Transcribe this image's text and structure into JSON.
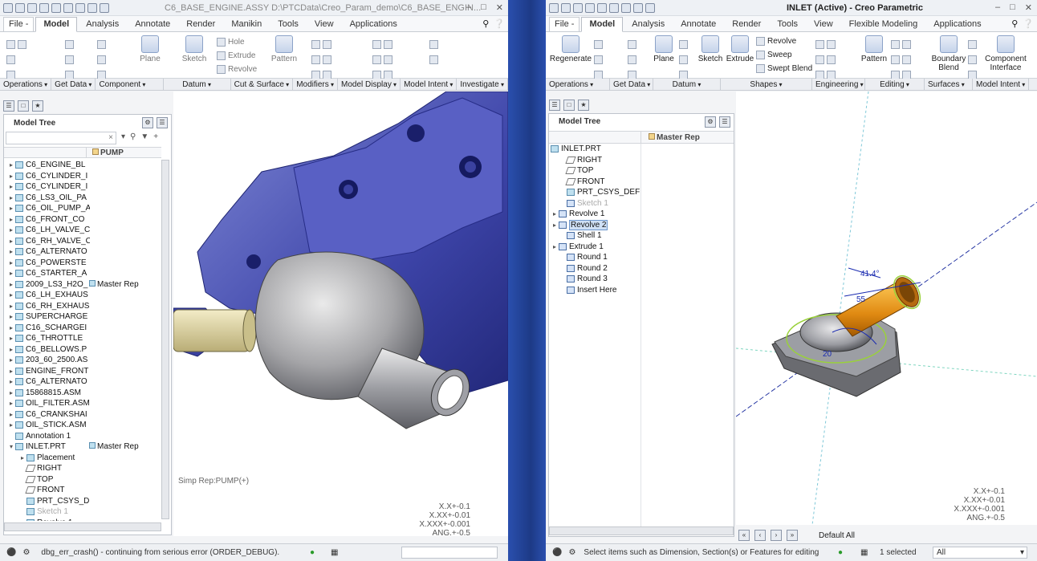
{
  "left": {
    "title": "C6_BASE_ENGINE.ASSY D:\\PTCData\\Creo_Param_demo\\C6_BASE_ENGIN...",
    "menu": [
      "File -",
      "Model",
      "Analysis",
      "Annotate",
      "Render",
      "Manikin",
      "Tools",
      "View",
      "Applications"
    ],
    "ribbon": {
      "plane": "Plane",
      "sketch": "Sketch",
      "hole": "Hole",
      "extrude": "Extrude",
      "revolve": "Revolve",
      "pattern": "Pattern"
    },
    "groups": [
      "Operations",
      "Get Data",
      "Component",
      "Datum",
      "Cut & Surface",
      "Modifiers",
      "Model Display",
      "Model Intent",
      "Investigate"
    ],
    "tree_title": "Model Tree",
    "col_header": "PUMP",
    "tree_rows": [
      {
        "label": "C6_ENGINE_BL",
        "rep": ""
      },
      {
        "label": "C6_CYLINDER_I",
        "rep": ""
      },
      {
        "label": "C6_CYLINDER_I",
        "rep": ""
      },
      {
        "label": "C6_LS3_OIL_PA",
        "rep": ""
      },
      {
        "label": "C6_OIL_PUMP_A",
        "rep": ""
      },
      {
        "label": "C6_FRONT_CO",
        "rep": ""
      },
      {
        "label": "C6_LH_VALVE_C",
        "rep": ""
      },
      {
        "label": "C6_RH_VALVE_C",
        "rep": ""
      },
      {
        "label": "C6_ALTERNATO",
        "rep": ""
      },
      {
        "label": "C6_POWERSTE",
        "rep": ""
      },
      {
        "label": "C6_STARTER_A",
        "rep": ""
      },
      {
        "label": "2009_LS3_H2O_",
        "rep": "Master Rep"
      },
      {
        "label": "C6_LH_EXHAUS",
        "rep": ""
      },
      {
        "label": "C6_RH_EXHAUS",
        "rep": ""
      },
      {
        "label": "SUPERCHARGE",
        "rep": ""
      },
      {
        "label": "C16_SCHARGEI",
        "rep": ""
      },
      {
        "label": "C6_THROTTLE",
        "rep": ""
      },
      {
        "label": "C6_BELLOWS.P",
        "rep": ""
      },
      {
        "label": "203_60_2500.AS",
        "rep": ""
      },
      {
        "label": "ENGINE_FRONT",
        "rep": ""
      },
      {
        "label": "C6_ALTERNATO",
        "rep": ""
      },
      {
        "label": "15868815.ASM",
        "rep": ""
      },
      {
        "label": "OIL_FILTER.ASM",
        "rep": ""
      },
      {
        "label": "C6_CRANKSHAI",
        "rep": ""
      },
      {
        "label": "OIL_STICK.ASM",
        "rep": ""
      },
      {
        "label": "Annotation 1",
        "rep": ""
      },
      {
        "label": "INLET.PRT",
        "rep": "Master Rep"
      },
      {
        "label": "Placement",
        "rep": ""
      },
      {
        "label": "RIGHT",
        "rep": ""
      },
      {
        "label": "TOP",
        "rep": ""
      },
      {
        "label": "FRONT",
        "rep": ""
      },
      {
        "label": "PRT_CSYS_D",
        "rep": ""
      },
      {
        "label": "Sketch 1",
        "rep": ""
      },
      {
        "label": "Revolve 1",
        "rep": ""
      }
    ],
    "simp_rep": "Simp Rep:PUMP(+)",
    "tolerances": [
      "X.X+-0.1",
      "X.XX+-0.01",
      "X.XXX+-0.001",
      "ANG.+-0.5"
    ],
    "status": "dbg_err_crash() - continuing from serious error (ORDER_DEBUG)."
  },
  "right": {
    "title": "INLET (Active) - Creo Parametric",
    "menu": [
      "File -",
      "Model",
      "Analysis",
      "Annotate",
      "Render",
      "Tools",
      "View",
      "Flexible Modeling",
      "Applications"
    ],
    "ribbon": {
      "regenerate": "Regenerate",
      "plane": "Plane",
      "sketch": "Sketch",
      "extrude": "Extrude",
      "revolve": "Revolve",
      "sweep": "Sweep",
      "swept_blend": "Swept Blend",
      "pattern": "Pattern",
      "boundary_blend": "Boundary Blend",
      "component_interface": "Component Interface"
    },
    "groups": [
      "Operations",
      "Get Data",
      "Datum",
      "Shapes",
      "Engineering",
      "Editing",
      "Surfaces",
      "Model Intent"
    ],
    "tree_title": "Model Tree",
    "col_header": "Master Rep",
    "tree_rows": [
      {
        "label": "INLET.PRT",
        "state": "normal"
      },
      {
        "label": "RIGHT",
        "state": "normal"
      },
      {
        "label": "TOP",
        "state": "normal"
      },
      {
        "label": "FRONT",
        "state": "normal"
      },
      {
        "label": "PRT_CSYS_DEF",
        "state": "normal"
      },
      {
        "label": "Sketch 1",
        "state": "dim"
      },
      {
        "label": "Revolve 1",
        "state": "normal"
      },
      {
        "label": "Revolve 2",
        "state": "selected"
      },
      {
        "label": "Shell 1",
        "state": "normal"
      },
      {
        "label": "Extrude 1",
        "state": "normal"
      },
      {
        "label": "Round 1",
        "state": "normal"
      },
      {
        "label": "Round 2",
        "state": "normal"
      },
      {
        "label": "Round 3",
        "state": "normal"
      },
      {
        "label": "Insert Here",
        "state": "normal"
      }
    ],
    "dims": [
      "41.4°",
      "55",
      "20"
    ],
    "tolerances": [
      "X.X+-0.1",
      "X.XX+-0.01",
      "X.XXX+-0.001",
      "ANG.+-0.5"
    ],
    "default_all": "Default All",
    "status": "Select items such as Dimension, Section(s) or Features for editing",
    "selected": "1 selected",
    "filter": "All"
  }
}
